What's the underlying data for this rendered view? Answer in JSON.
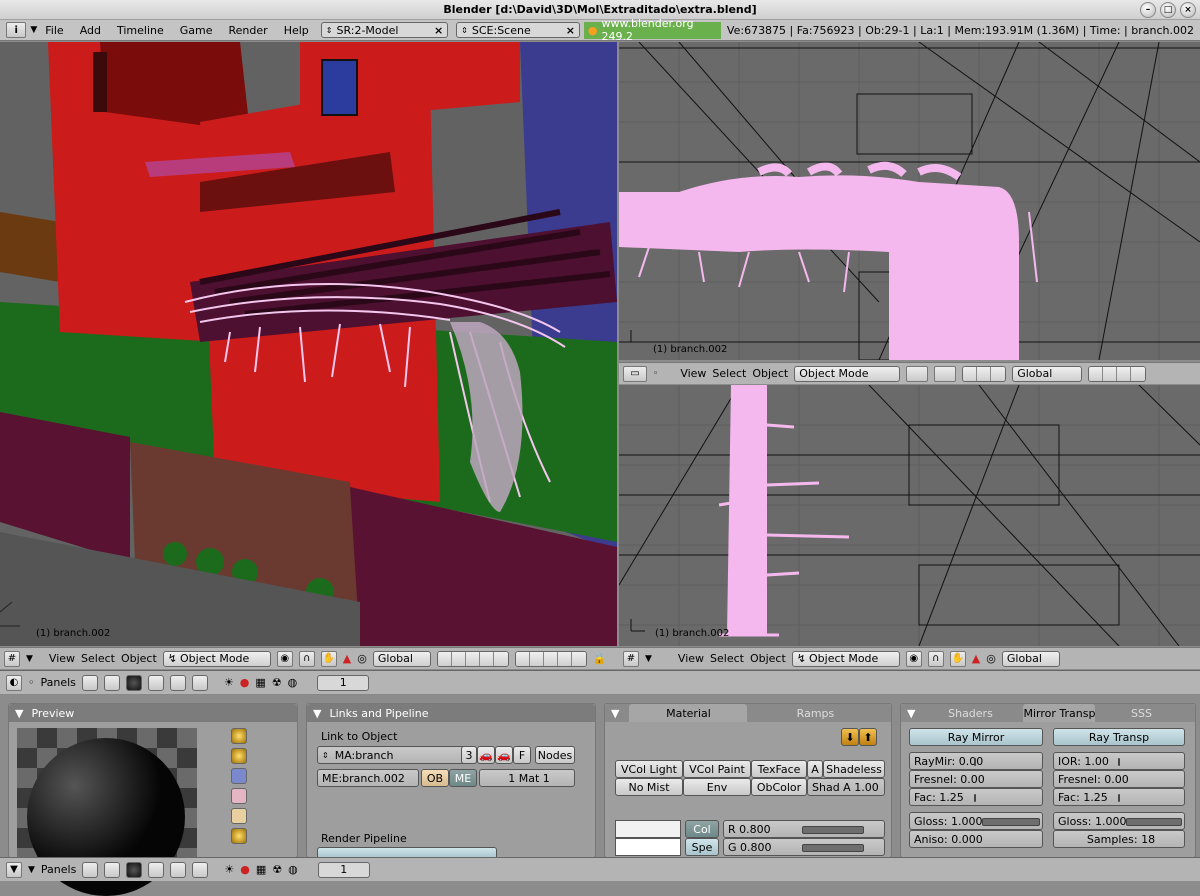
{
  "window": {
    "title": "Blender [d:\\David\\3D\\MoI\\Extraditado\\extra.blend]"
  },
  "menubar": {
    "items": [
      "File",
      "Add",
      "Timeline",
      "Game",
      "Render",
      "Help"
    ],
    "screen": "SR:2-Model",
    "scene": "SCE:Scene",
    "url": "www.blender.org 249.2",
    "stats": "Ve:673875 | Fa:756923 | Ob:29-1 | La:1 | Mem:193.91M (1.36M) | Time: | branch.002"
  },
  "viewports": {
    "left": {
      "label": "(1) branch.002"
    },
    "top_right": {
      "label": "(1) branch.002"
    },
    "bottom_right": {
      "label": "(1) branch.002"
    }
  },
  "viewheader": {
    "view": "View",
    "select": "Select",
    "object": "Object",
    "mode": "Object Mode",
    "orientation": "Global"
  },
  "buttons_header": {
    "panels": "Panels",
    "frame": "1"
  },
  "preview": {
    "title": "Preview"
  },
  "links": {
    "title": "Links and Pipeline",
    "link_to_object": "Link to Object",
    "material_name": "MA:branch",
    "users": "3",
    "f_label": "F",
    "nodes": "Nodes",
    "mesh_name": "ME:branch.002",
    "ob": "OB",
    "me": "ME",
    "mat_count": "1 Mat 1",
    "render_pipeline": "Render Pipeline"
  },
  "material": {
    "tab_material": "Material",
    "tab_ramps": "Ramps",
    "vcol_light": "VCol Light",
    "vcol_paint": "VCol Paint",
    "texface": "TexFace",
    "a": "A",
    "shadeless": "Shadeless",
    "no_mist": "No Mist",
    "env": "Env",
    "obcolor": "ObColor",
    "shad_a": "Shad A 1.00",
    "col": "Col",
    "spe": "Spe",
    "r": "R 0.800",
    "g": "G 0.800"
  },
  "shaders": {
    "tab_shaders": "Shaders",
    "tab_mirror": "Mirror Transp",
    "tab_sss": "SSS",
    "ray_mirror": "Ray Mirror",
    "ray_transp": "Ray Transp",
    "raymir": "RayMir: 0.00",
    "fresnel_l": "Fresnel: 0.00",
    "fac_l": "Fac: 1.25",
    "ior": "IOR: 1.00",
    "fresnel_r": "Fresnel: 0.00",
    "fac_r": "Fac: 1.25",
    "gloss_l": "Gloss: 1.000",
    "aniso": "Aniso: 0.000",
    "gloss_r": "Gloss: 1.000",
    "samples": "Samples: 18"
  },
  "bottombar": {
    "panels": "Panels",
    "frame": "1"
  }
}
